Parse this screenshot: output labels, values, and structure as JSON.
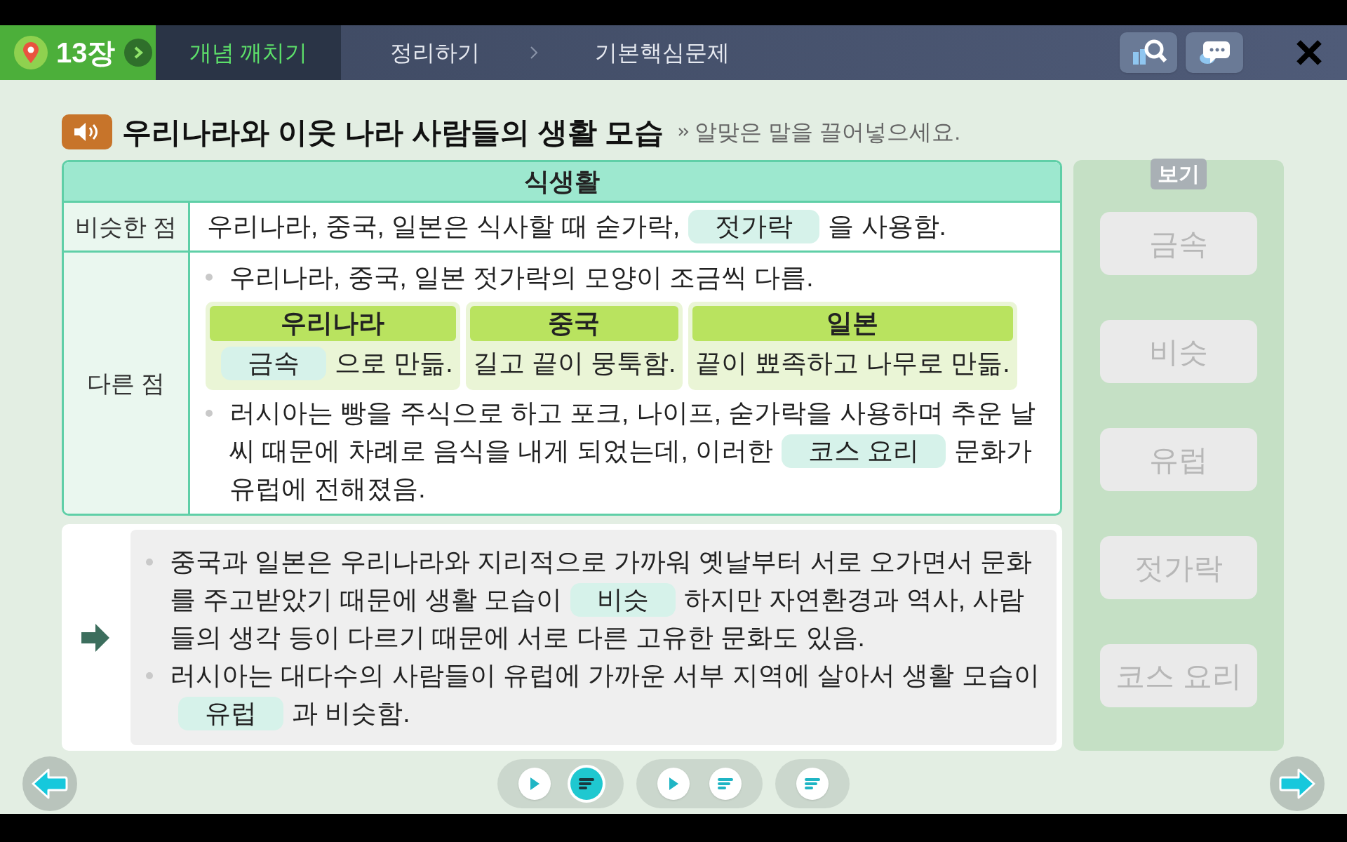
{
  "nav": {
    "chapter": "13장",
    "steps": [
      {
        "label": "개념 깨치기",
        "selected": true
      },
      {
        "label": "정리하기",
        "selected": false
      },
      {
        "label": "기본핵심문제",
        "selected": false
      }
    ]
  },
  "title": "우리나라와 이웃 나라 사람들의 생활 모습",
  "instruction": "알맞은 말을 끌어넣으세요.",
  "table": {
    "header": "식생활",
    "similar": {
      "label": "비슷한 점",
      "parts": [
        {
          "kind": "text",
          "text": "우리나라, 중국, 일본은 식사할 때 숟가락,"
        },
        {
          "kind": "blank",
          "text": "젓가락"
        },
        {
          "kind": "text",
          "text": "을 사용함."
        }
      ]
    },
    "different": {
      "label": "다른 점",
      "bullet_1": [
        {
          "kind": "text",
          "text": "우리나라, 중국, 일본 젓가락의 모양이 조금씩 다름."
        }
      ],
      "countries": [
        {
          "name": "우리나라",
          "parts": [
            {
              "kind": "blank",
              "text": "금속"
            },
            {
              "kind": "text",
              "text": "으로 만듦."
            }
          ]
        },
        {
          "name": "중국",
          "parts": [
            {
              "kind": "text",
              "text": "길고 끝이 뭉툭함."
            }
          ]
        },
        {
          "name": "일본",
          "parts": [
            {
              "kind": "text",
              "text": "끝이 뾰족하고 나무로 만듦."
            }
          ]
        }
      ],
      "bullet_2": [
        {
          "kind": "text",
          "text": "러시아는 빵을 주식으로 하고 포크, 나이프, 숟가락을 사용하며 추운 날씨 때문에 차례로 음식을 내게 되었는데, 이러한"
        },
        {
          "kind": "blank",
          "text": "코스 요리"
        },
        {
          "kind": "text",
          "text": "문화가 유럽에 전해졌음."
        }
      ]
    }
  },
  "summary": [
    [
      {
        "kind": "text",
        "text": "중국과 일본은 우리나라와 지리적으로 가까워 옛날부터 서로 오가면서 문화를 주고받았기 때문에 생활 모습이"
      },
      {
        "kind": "blank",
        "text": "비슷"
      },
      {
        "kind": "text",
        "text": "하지만 자연환경과 역사, 사람들의 생각 등이 다르기 때문에 서로 다른 고유한 문화도 있음."
      }
    ],
    [
      {
        "kind": "text",
        "text": "러시아는 대다수의 사람들이 유럽에 가까운 서부 지역에 살아서 생활 모습이"
      },
      {
        "kind": "blank",
        "text": "유럽"
      },
      {
        "kind": "text",
        "text": "과 비슷함."
      }
    ]
  ],
  "options": {
    "header": "보기",
    "items": [
      {
        "text": "금속",
        "used": true
      },
      {
        "text": "비슷",
        "used": true
      },
      {
        "text": "유럽",
        "used": true
      },
      {
        "text": "젓가락",
        "used": true
      },
      {
        "text": "코스 요리",
        "used": true
      }
    ]
  },
  "controls": [
    [
      {
        "kind": "play",
        "selected": false
      },
      {
        "kind": "script",
        "selected": true
      }
    ],
    [
      {
        "kind": "play",
        "selected": false
      },
      {
        "kind": "script",
        "selected": false
      }
    ],
    [
      {
        "kind": "script",
        "selected": false
      }
    ]
  ]
}
